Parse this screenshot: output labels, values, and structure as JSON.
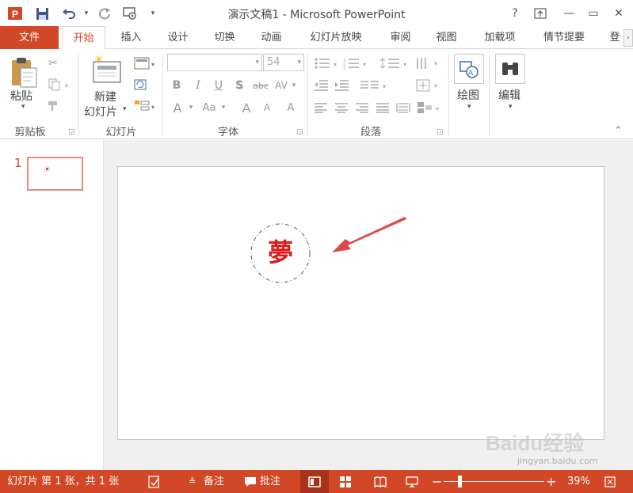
{
  "window": {
    "title": "演示文稿1 - Microsoft PowerPoint",
    "help_glyph": "?",
    "minimize_glyph": "—",
    "restore_glyph": "▭",
    "close_glyph": "✕"
  },
  "tabs": [
    {
      "label": "文件"
    },
    {
      "label": "开始"
    },
    {
      "label": "插入"
    },
    {
      "label": "设计"
    },
    {
      "label": "切换"
    },
    {
      "label": "动画"
    },
    {
      "label": "幻灯片放映"
    },
    {
      "label": "审阅"
    },
    {
      "label": "视图"
    },
    {
      "label": "加载项"
    },
    {
      "label": "情节提要"
    },
    {
      "label": "登"
    }
  ],
  "ribbon": {
    "clipboard": {
      "group_label": "剪贴板",
      "paste_label": "粘贴"
    },
    "slides": {
      "group_label": "幻灯片",
      "new_slide_line1": "新建",
      "new_slide_line2": "幻灯片"
    },
    "font": {
      "group_label": "字体",
      "font_name": "",
      "font_size": "54",
      "bold": "B",
      "italic": "I",
      "underline": "U",
      "shadow": "S",
      "strike": "abc",
      "spacing": "AV",
      "font_color": "A",
      "change_case": "Aa",
      "grow_font": "A",
      "shrink_font": "A",
      "clear_format": "A"
    },
    "paragraph": {
      "group_label": "段落"
    },
    "drawing": {
      "label": "绘图"
    },
    "editing": {
      "label": "编辑"
    }
  },
  "thumbnails": [
    {
      "number": "1"
    }
  ],
  "slide": {
    "char": "夢"
  },
  "status": {
    "slide_info": "幻灯片 第 1 张，共 1 张",
    "notes": "备注",
    "comments": "批注",
    "zoom_minus": "−",
    "zoom_plus": "+",
    "zoom": "39%",
    "zoom_level": 0.39
  },
  "colors": {
    "accent": "#d24726",
    "char_red": "#e11b1b",
    "arrow": "#e04848"
  },
  "watermark": {
    "text": "Baidu经验",
    "url": "jingyan.baidu.com"
  }
}
